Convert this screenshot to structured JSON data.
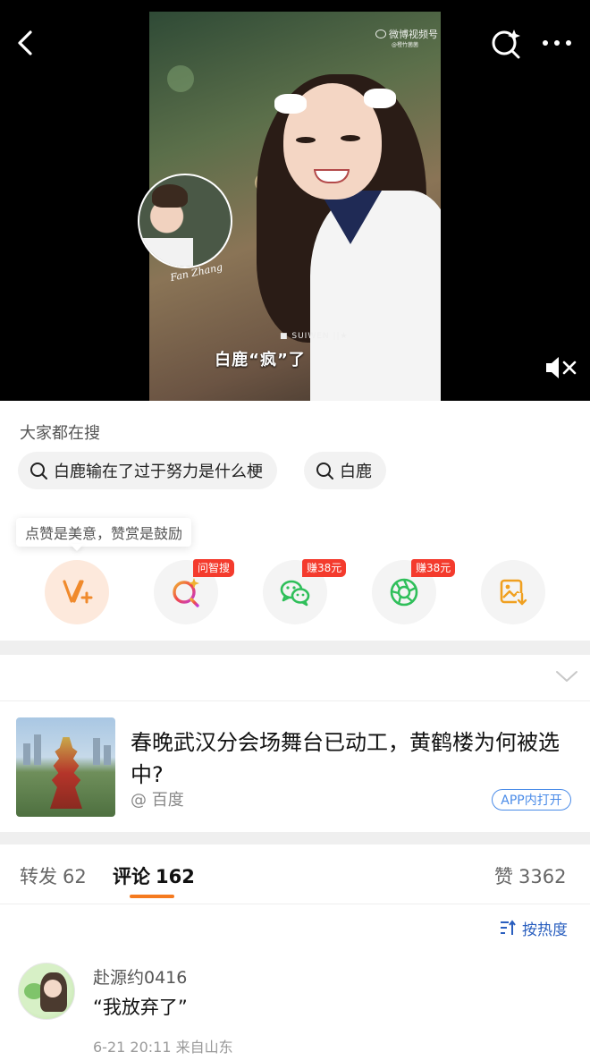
{
  "video": {
    "watermark_brand": "微博视频号",
    "watermark_sub": "@橙竹菌菌",
    "brand_text": "■ SUIWEN ||★",
    "caption": "白鹿“疯”了",
    "inset_signature": "Fan Zhang"
  },
  "nav": {
    "back_icon": "back-arrow-icon",
    "search_icon": "sparkle-search-icon",
    "more_icon": "more-dots-icon",
    "mute_icon": "muted-speaker-icon"
  },
  "trending": {
    "title": "大家都在搜",
    "chips": [
      {
        "label": "白鹿输在了过于努力是什么梗",
        "icon": "search-icon"
      },
      {
        "label": "白鹿",
        "icon": "search-icon"
      }
    ]
  },
  "actions": {
    "tip": "点赞是美意，赞赏是鼓励",
    "items": [
      {
        "icon": "reward-v-plus-icon",
        "badge": ""
      },
      {
        "icon": "ask-zhisou-icon",
        "badge": "问智搜"
      },
      {
        "icon": "wechat-icon",
        "badge": "赚38元"
      },
      {
        "icon": "moments-icon",
        "badge": "赚38元"
      },
      {
        "icon": "save-image-icon",
        "badge": ""
      }
    ]
  },
  "card": {
    "title": "春晚武汉分会场舞台已动工，黄鹤楼为何被选中?",
    "source": "@ 百度",
    "app_button": "APP内打开"
  },
  "tabs": {
    "repost_label": "转发",
    "repost_count": "62",
    "comment_label": "评论",
    "comment_count": "162",
    "like_label": "赞",
    "like_count": "3362"
  },
  "sort": {
    "label": "按热度"
  },
  "comment": {
    "user": "赴源约0416",
    "text": "“我放弃了”",
    "meta": "6-21 20:11  来自山东"
  },
  "colors": {
    "accent_orange": "#f57a1f",
    "link_blue": "#4a8be8",
    "badge_red": "#f43b2d",
    "wechat_green": "#2fbf5a"
  }
}
